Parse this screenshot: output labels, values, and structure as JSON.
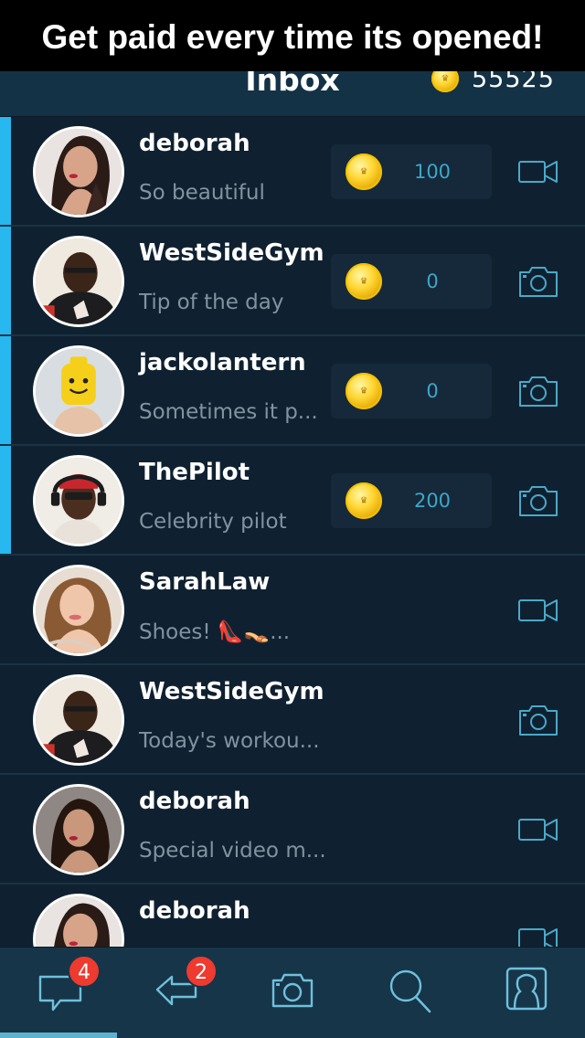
{
  "banner": {
    "text": "Get paid every time its opened!"
  },
  "header": {
    "title": "Inbox",
    "coin_balance": "55525"
  },
  "messages": [
    {
      "sender": "deborah",
      "preview": "So beautiful",
      "tip": "100",
      "media": "video-icon",
      "unread": true
    },
    {
      "sender": "WestSideGym",
      "preview": "Tip of the day",
      "tip": "0",
      "media": "camera-icon",
      "unread": true
    },
    {
      "sender": "jackolantern",
      "preview": "Sometimes it p...",
      "tip": "0",
      "media": "camera-icon",
      "unread": true
    },
    {
      "sender": "ThePilot",
      "preview": "Celebrity pilot",
      "tip": "200",
      "media": "camera-icon",
      "unread": true
    },
    {
      "sender": "SarahLaw",
      "preview": "Shoes! 👠👡...",
      "media": "video-icon",
      "unread": false
    },
    {
      "sender": "WestSideGym",
      "preview": "Today's workou...",
      "media": "camera-icon",
      "unread": false
    },
    {
      "sender": "deborah",
      "preview": "Special video m...",
      "media": "video-icon",
      "unread": false
    },
    {
      "sender": "deborah",
      "preview": "",
      "media": "video-icon",
      "unread": false
    }
  ],
  "tabbar": {
    "inbox_badge": "4",
    "replies_badge": "2",
    "tabs": [
      "inbox-icon",
      "reply-icon",
      "camera-icon",
      "search-icon",
      "profile-icon"
    ]
  },
  "colors": {
    "background": "#0f2130",
    "header": "#143246",
    "unread_accent": "#27b8f0",
    "badge": "#ee3a2f",
    "icon_stroke": "#4aa9c9"
  }
}
